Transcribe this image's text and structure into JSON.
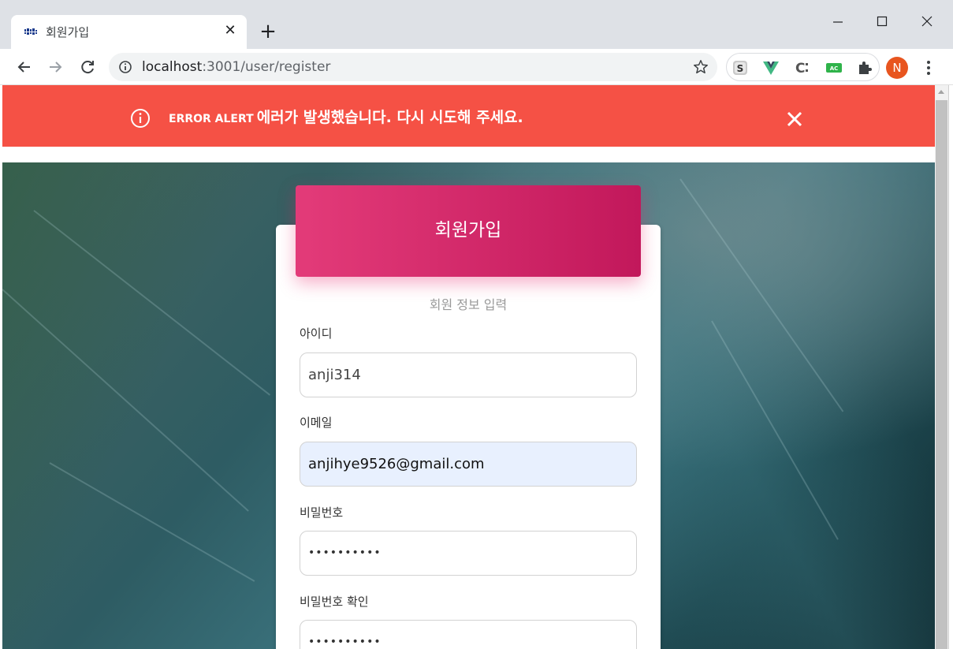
{
  "browser": {
    "tab": {
      "title": "회원가입",
      "favicon": "site-favicon",
      "close_icon": "close-icon"
    },
    "new_tab_icon": "plus-icon",
    "window_controls": [
      "minimize-icon",
      "maximize-icon",
      "close-icon"
    ],
    "nav": {
      "back": "arrow-left-icon",
      "forward": "arrow-right-icon",
      "reload": "reload-icon"
    },
    "address_bar": {
      "host": "localhost",
      "port_path": ":3001/user/register"
    },
    "extensions": [
      "s-extension-icon",
      "vue-devtools-icon",
      "c-extension-icon",
      "ac-extension-icon",
      "puzzle-icon"
    ],
    "profile_initial": "N"
  },
  "alert": {
    "label": "ERROR ALERT",
    "message": "에러가 발생했습니다. 다시 시도해 주세요.",
    "color": "#f55145"
  },
  "form": {
    "title": "회원가입",
    "subtitle": "회원 정보 입력",
    "accent": "#e91e63",
    "fields": [
      {
        "label": "아이디",
        "value": "anji314"
      },
      {
        "label": "이메일",
        "value": "anjihye9526@gmail.com"
      },
      {
        "label": "비밀번호",
        "value": "••••••••••"
      },
      {
        "label": "비밀번호 확인",
        "value": "••••••••••"
      }
    ]
  }
}
